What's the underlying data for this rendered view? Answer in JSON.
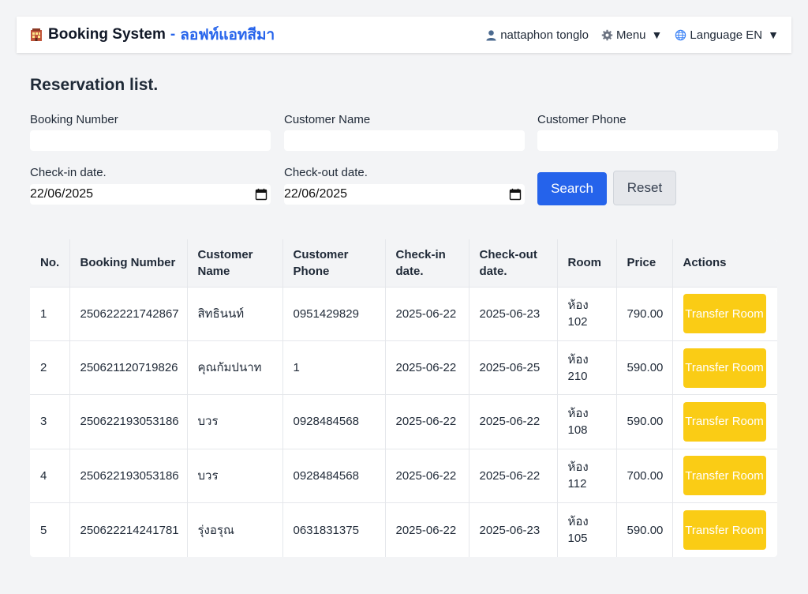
{
  "header": {
    "brand_title": "Booking System",
    "brand_separator": "-",
    "brand_subtitle": "ลอฟท์แอทสีมา",
    "user_name": "nattaphon tonglo",
    "menu_label": "Menu",
    "language_label": "Language EN",
    "dropdown_arrow": "▼",
    "icons": [
      "hotel-icon",
      "user-icon",
      "gear-icon",
      "globe-icon"
    ]
  },
  "page": {
    "title": "Reservation list."
  },
  "filters": {
    "booking_number": {
      "label": "Booking Number",
      "value": "",
      "placeholder": ""
    },
    "customer_name": {
      "label": "Customer Name",
      "value": "",
      "placeholder": ""
    },
    "customer_phone": {
      "label": "Customer Phone",
      "value": "",
      "placeholder": ""
    },
    "checkin_date": {
      "label": "Check-in date.",
      "value": "22/06/2025"
    },
    "checkout_date": {
      "label": "Check-out date.",
      "value": "22/06/2025"
    },
    "search_label": "Search",
    "reset_label": "Reset"
  },
  "table": {
    "headers": [
      "No.",
      "Booking Number",
      "Customer Name",
      "Customer Phone",
      "Check-in date.",
      "Check-out date.",
      "Room",
      "Price",
      "Actions"
    ],
    "action_label": "Transfer Room",
    "rows": [
      {
        "no": "1",
        "booking_number": "250622221742867",
        "customer_name": "สิทธินนท์",
        "phone": "0951429829",
        "checkin": "2025-06-22",
        "checkout": "2025-06-23",
        "room": "ห้อง 102",
        "price": "790.00"
      },
      {
        "no": "2",
        "booking_number": "250621120719826",
        "customer_name": "คุณกัมปนาท",
        "phone": "1",
        "checkin": "2025-06-22",
        "checkout": "2025-06-25",
        "room": "ห้อง 210",
        "price": "590.00"
      },
      {
        "no": "3",
        "booking_number": "250622193053186",
        "customer_name": "บวร",
        "phone": "0928484568",
        "checkin": "2025-06-22",
        "checkout": "2025-06-22",
        "room": "ห้อง 108",
        "price": "590.00"
      },
      {
        "no": "4",
        "booking_number": "250622193053186",
        "customer_name": "บวร",
        "phone": "0928484568",
        "checkin": "2025-06-22",
        "checkout": "2025-06-22",
        "room": "ห้อง 112",
        "price": "700.00"
      },
      {
        "no": "5",
        "booking_number": "250622214241781",
        "customer_name": "รุ่งอรุณ",
        "phone": "0631831375",
        "checkin": "2025-06-22",
        "checkout": "2025-06-23",
        "room": "ห้อง 105",
        "price": "590.00"
      }
    ]
  },
  "colors": {
    "primary": "#2563eb",
    "warning": "#facc15",
    "background": "#f3f4f6"
  }
}
